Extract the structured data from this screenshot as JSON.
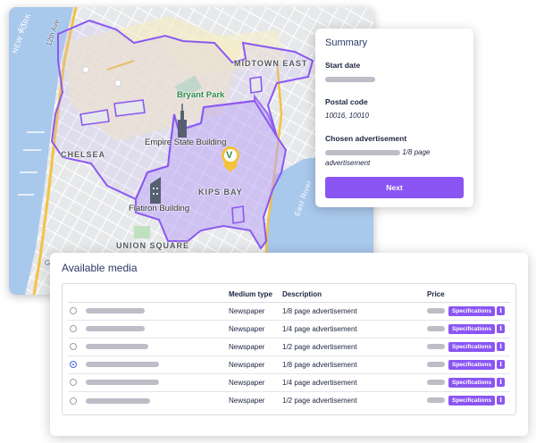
{
  "map": {
    "labels": {
      "midtown_east": "MIDTOWN EAST",
      "bryant_park": "Bryant Park",
      "empire_state": "Empire State Building",
      "chelsea": "CHELSEA",
      "kips_bay": "KIPS BAY",
      "flatiron": "Flatiron Building",
      "union_square": "UNION SQUARE",
      "east_river": "East River",
      "river_left": "NEW YORK",
      "river_left_2": "EY",
      "street_12": "12th Ave",
      "street_g": "G"
    },
    "colors": {
      "region_fill": "#b9a3f5",
      "region_stroke": "#8c58f0",
      "water": "#a8c8ec",
      "marker": "#f4c23b"
    },
    "marker_letter": "V"
  },
  "summary": {
    "title": "Summary",
    "start_date_label": "Start date",
    "postal_code_label": "Postal code",
    "postal_code_value": "10016, 10010",
    "chosen_ad_label": "Chosen advertisement",
    "chosen_ad_value_tail": "1/8 page",
    "chosen_ad_value_line2": "advertisement",
    "next_label": "Next"
  },
  "media": {
    "title": "Available media",
    "columns": {
      "medium_type": "Medium type",
      "description": "Description",
      "price": "Price"
    },
    "spec_label": "Specifications",
    "info_label": "i",
    "rows": [
      {
        "medium": "Newspaper",
        "description": "1/8 page advertisement",
        "selected": false
      },
      {
        "medium": "Newspaper",
        "description": "1/4 page advertisement",
        "selected": false
      },
      {
        "medium": "Newspaper",
        "description": "1/2 page advertisement",
        "selected": false
      },
      {
        "medium": "Newspaper",
        "description": "1/8 page advertisement",
        "selected": true
      },
      {
        "medium": "Newspaper",
        "description": "1/4 page advertisement",
        "selected": false
      },
      {
        "medium": "Newspaper",
        "description": "1/2 page advertisement",
        "selected": false
      }
    ]
  }
}
